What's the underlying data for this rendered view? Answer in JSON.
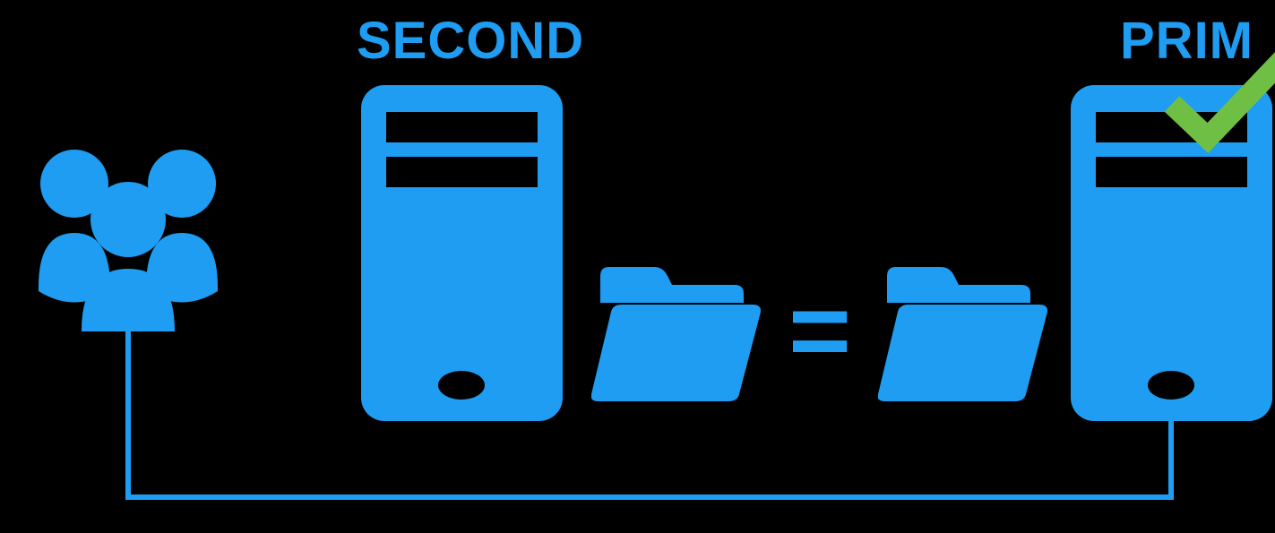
{
  "colors": {
    "blue": "#1E9DF2",
    "green": "#6FBF44",
    "black": "#000000"
  },
  "labels": {
    "second": "SECOND",
    "prim": "PRIM",
    "equals": "="
  },
  "icons": {
    "users": "users-icon",
    "server_second": "server-icon",
    "server_prim": "server-icon",
    "folder_left": "folder-icon",
    "folder_right": "folder-icon",
    "checkmark": "checkmark-icon"
  },
  "connector": {
    "from": "users",
    "to": "server_prim"
  }
}
